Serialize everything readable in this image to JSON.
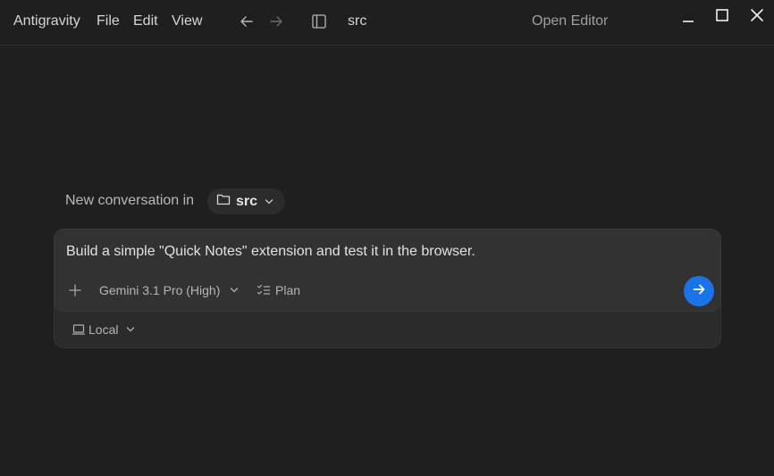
{
  "menu": {
    "app_name": "Antigravity",
    "file": "File",
    "edit": "Edit",
    "view": "View"
  },
  "titlebar": {
    "folder": "src",
    "open_editor": "Open Editor",
    "icons": [
      "back-arrow-icon",
      "forward-arrow-icon",
      "sidebar-toggle-icon",
      "minimize-icon",
      "maximize-icon",
      "close-icon"
    ]
  },
  "conversation": {
    "heading": "New conversation in",
    "folder_chip": "src",
    "prompt": "Build a simple \"Quick Notes\" extension and test it in the browser.",
    "model": "Gemini 3.1 Pro (High)",
    "mode": "Plan",
    "environment": "Local"
  },
  "colors": {
    "background": "#1f1f1f",
    "send_button": "#1a73e8"
  }
}
